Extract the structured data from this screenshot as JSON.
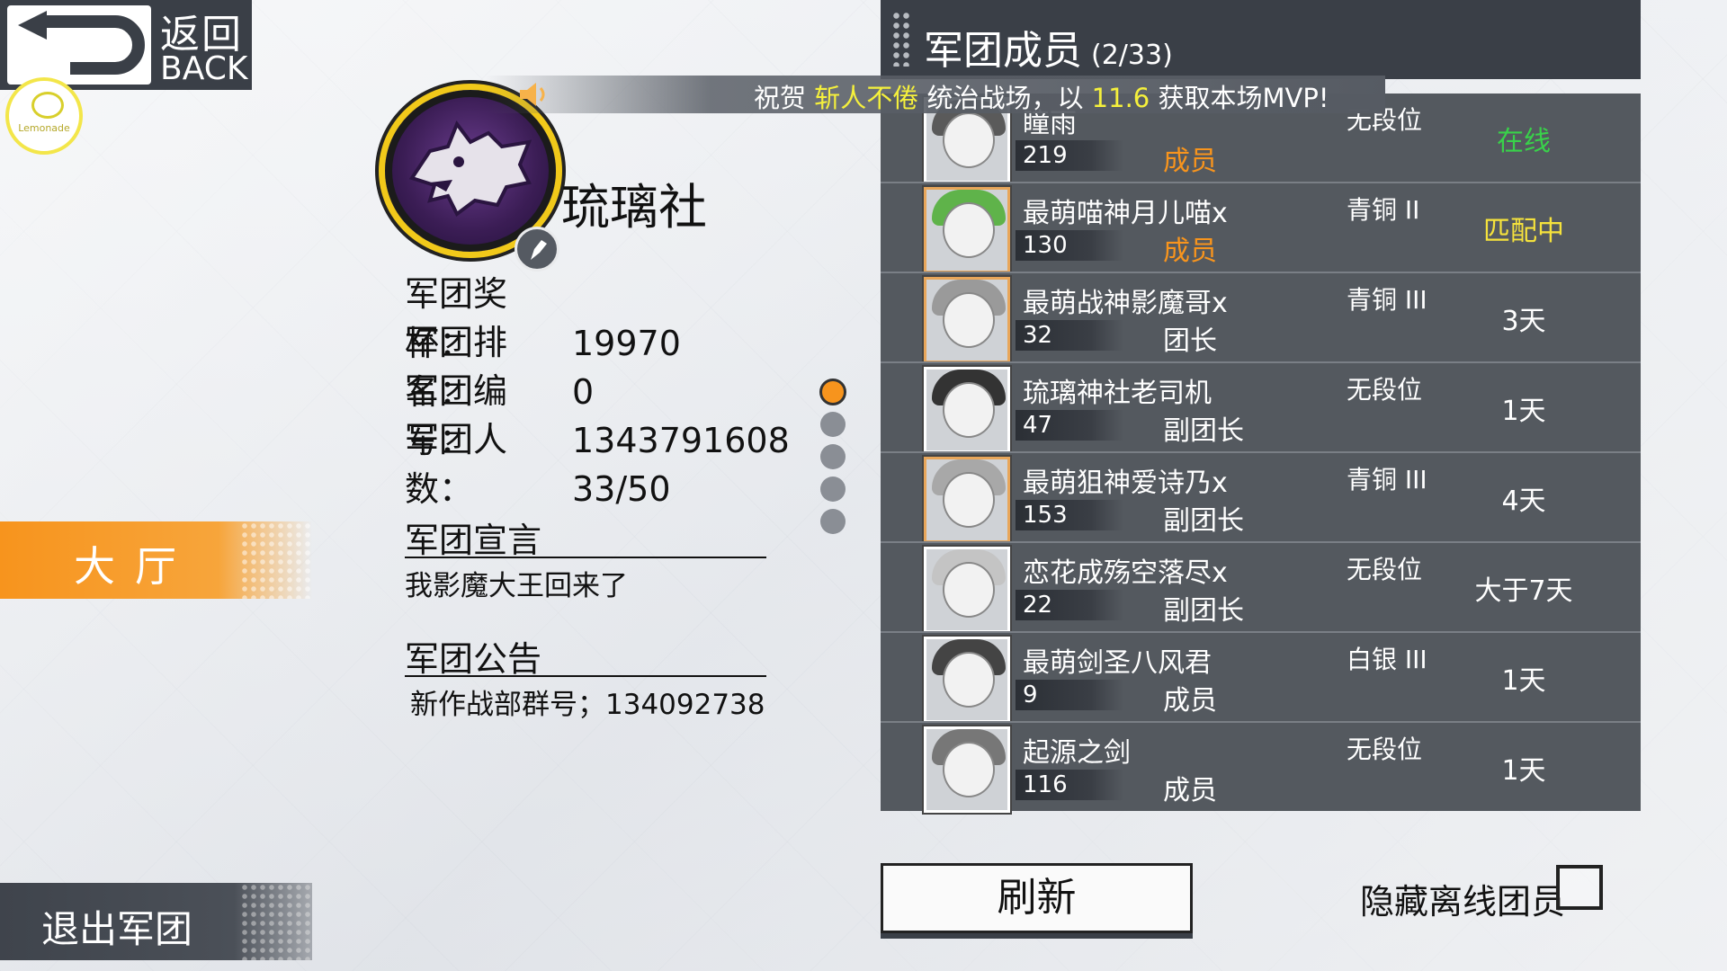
{
  "back": {
    "zh": "返回",
    "en": "BACK"
  },
  "logo_text": "Lemonade",
  "nav": {
    "hall": "大厅",
    "exit": "退出军团"
  },
  "guild": {
    "name": "琉璃社",
    "info": [
      {
        "k": "军团奖杯：",
        "v": "19970"
      },
      {
        "k": "军团排名：",
        "v": "0"
      },
      {
        "k": "军团编号：",
        "v": "1343791608"
      },
      {
        "k": "军团人数：",
        "v": "33/50"
      }
    ],
    "declaration_title": "军团宣言",
    "declaration": "我影魔大王回来了",
    "notice_title": "军团公告",
    "notice": "新作战部群号；134092738"
  },
  "page_dots": {
    "count": 5,
    "active": 1
  },
  "panel": {
    "title": "军团成员",
    "count": "(2/33)"
  },
  "broadcast": {
    "pre": "祝贺 ",
    "name": "斩人不倦",
    "mid": " 统治战场，以 ",
    "score": "11.6",
    "post": " 获取本场MVP!"
  },
  "members": [
    {
      "name": "瞳雨",
      "level": "219",
      "role": "成员",
      "rank": "无段位",
      "status": "在线",
      "role_color": "orange",
      "status_color": "green",
      "frame": "plain"
    },
    {
      "name": "最萌喵神月儿喵x",
      "level": "130",
      "role": "成员",
      "rank": "青铜 II",
      "status": "匹配中",
      "role_color": "orange",
      "status_color": "yellow",
      "frame": "gold"
    },
    {
      "name": "最萌战神影魔哥x",
      "level": "32",
      "role": "团长",
      "rank": "青铜 III",
      "status": "3天",
      "role_color": "white",
      "status_color": "white",
      "frame": "gold"
    },
    {
      "name": "琉璃神社老司机",
      "level": "47",
      "role": "副团长",
      "rank": "无段位",
      "status": "1天",
      "role_color": "white",
      "status_color": "white",
      "frame": "plain"
    },
    {
      "name": "最萌狙神爱诗乃x",
      "level": "153",
      "role": "副团长",
      "rank": "青铜 III",
      "status": "4天",
      "role_color": "white",
      "status_color": "white",
      "frame": "gold"
    },
    {
      "name": "恋花成殇空落尽x",
      "level": "22",
      "role": "副团长",
      "rank": "无段位",
      "status": "大于7天",
      "role_color": "white",
      "status_color": "white",
      "frame": "plain"
    },
    {
      "name": "最萌剑圣八风君",
      "level": "9",
      "role": "成员",
      "rank": "白银 III",
      "status": "1天",
      "role_color": "white",
      "status_color": "white",
      "frame": "plain"
    },
    {
      "name": "起源之剑",
      "level": "116",
      "role": "成员",
      "rank": "无段位",
      "status": "1天",
      "role_color": "white",
      "status_color": "white",
      "frame": "plain"
    }
  ],
  "buttons": {
    "refresh": "刷新",
    "hide_offline": "隐藏离线团员"
  },
  "colors": {
    "accent": "#f7941d",
    "panel": "#3a3f47",
    "online": "#39d14a",
    "matching": "#f5e23c"
  }
}
